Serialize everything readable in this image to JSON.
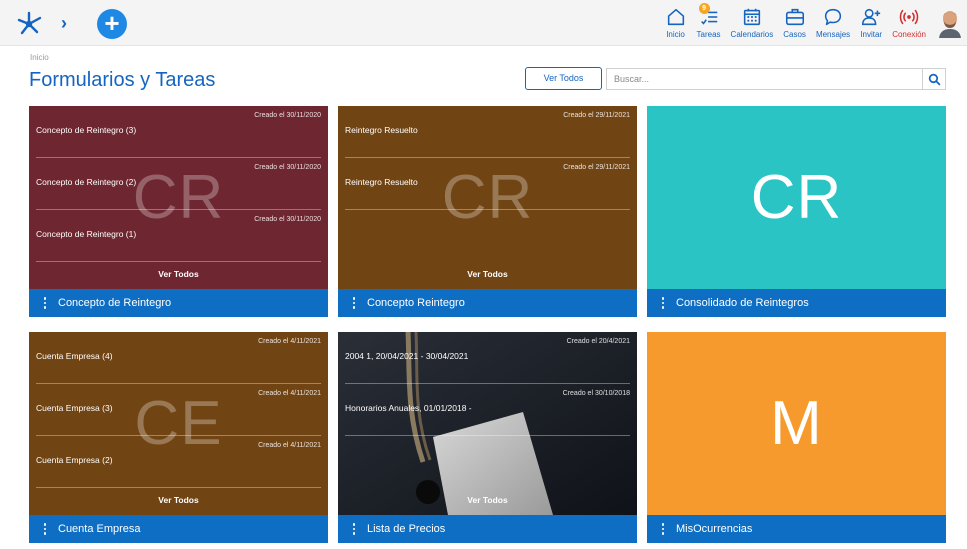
{
  "colors": {
    "accent": "#1565c0",
    "footer": "#0d6ec4",
    "card_maroon": "#6e2630",
    "card_brown": "#714414",
    "card_teal": "#2bc4c4",
    "card_orange": "#f79a2e",
    "alert": "#d32f2f",
    "badge": "#f5a623"
  },
  "nav": {
    "inicio": "Inicio",
    "tareas": "Tareas",
    "tareas_badge": "9",
    "calendarios": "Calendarios",
    "casos": "Casos",
    "mensajes": "Mensajes",
    "invitar": "Invitar",
    "conexion": "Conexión"
  },
  "breadcrumb": "Inicio",
  "page_title": "Formularios y Tareas",
  "ver_todos_button": "Ver Todos",
  "search": {
    "placeholder": "Buscar..."
  },
  "cards": [
    {
      "title": "Concepto de Reintegro",
      "initials": "CR",
      "see_all": "Ver Todos",
      "entries": [
        {
          "name": "Concepto de Reintegro (3)",
          "date": "Creado el 30/11/2020"
        },
        {
          "name": "Concepto de Reintegro (2)",
          "date": "Creado el 30/11/2020"
        },
        {
          "name": "Concepto de Reintegro (1)",
          "date": "Creado el 30/11/2020"
        }
      ]
    },
    {
      "title": "Concepto Reintegro",
      "initials": "CR",
      "see_all": "Ver Todos",
      "entries": [
        {
          "name": "Reintegro Resuelto",
          "date": "Creado el 29/11/2021"
        },
        {
          "name": "Reintegro Resuelto",
          "date": "Creado el 29/11/2021"
        }
      ]
    },
    {
      "title": "Consolidado de Reintegros",
      "initials": "CR"
    },
    {
      "title": "Cuenta Empresa",
      "initials": "CE",
      "see_all": "Ver Todos",
      "entries": [
        {
          "name": "Cuenta Empresa (4)",
          "date": "Creado el 4/11/2021"
        },
        {
          "name": "Cuenta Empresa (3)",
          "date": "Creado el 4/11/2021"
        },
        {
          "name": "Cuenta Empresa (2)",
          "date": "Creado el 4/11/2021"
        }
      ]
    },
    {
      "title": "Lista de Precios",
      "see_all": "Ver Todos",
      "entries": [
        {
          "name": "2004 1, 20/04/2021 - 30/04/2021",
          "date": "Creado el 20/4/2021"
        },
        {
          "name": "Honorarios Anuales, 01/01/2018 -",
          "date": "Creado el 30/10/2018"
        }
      ]
    },
    {
      "title": "MisOcurrencias",
      "initials": "M"
    }
  ]
}
